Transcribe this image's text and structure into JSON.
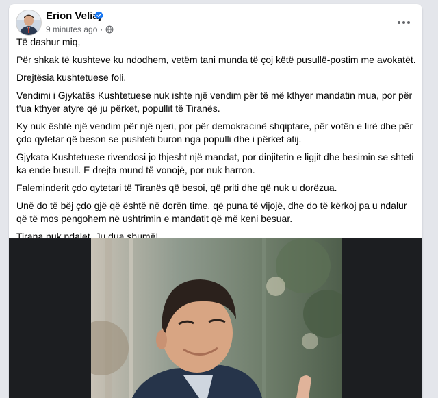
{
  "post": {
    "author": "Erion Veliaj",
    "timestamp": "9 minutes ago",
    "separator": "·",
    "audience_icon": "globe-icon",
    "more_icon": "more-horizontal-icon",
    "verified_icon": "verified-badge-icon",
    "verified_color": "#1877f2",
    "paragraphs": [
      "Të dashur miq,",
      "Për shkak të kushteve ku ndodhem, vetëm tani munda të çoj këtë pusullë-postim me avokatët.",
      "Drejtësia kushtetuese foli.",
      "Vendimi i Gjykatës Kushtetuese nuk ishte një vendim për të më kthyer mandatin mua, por për t'ua kthyer atyre që ju përket, popullit të Tiranës.",
      "Ky nuk është një vendim për një njeri, por për demokracinë shqiptare, për votën e lirë dhe për çdo qytetar që beson se pushteti buron nga populli dhe i përket atij.",
      "Gjykata Kushtetuese rivendosi jo thjesht një mandat, por dinjitetin e ligjit dhe besimin se shteti ka ende busull. E drejta mund të vonojë, por nuk harron.",
      "Faleminderit çdo qytetari të Tiranës që besoi, që priti dhe që nuk u dorëzua.",
      "Unë do të bëj çdo gjë që është në dorën time, që puna të vijojë, dhe do të kërkoj pa u ndalur që të mos pengohem në ushtrimin e mandatit që më keni besuar.",
      "Tirana nuk ndalet. Ju dua shumë!"
    ]
  }
}
